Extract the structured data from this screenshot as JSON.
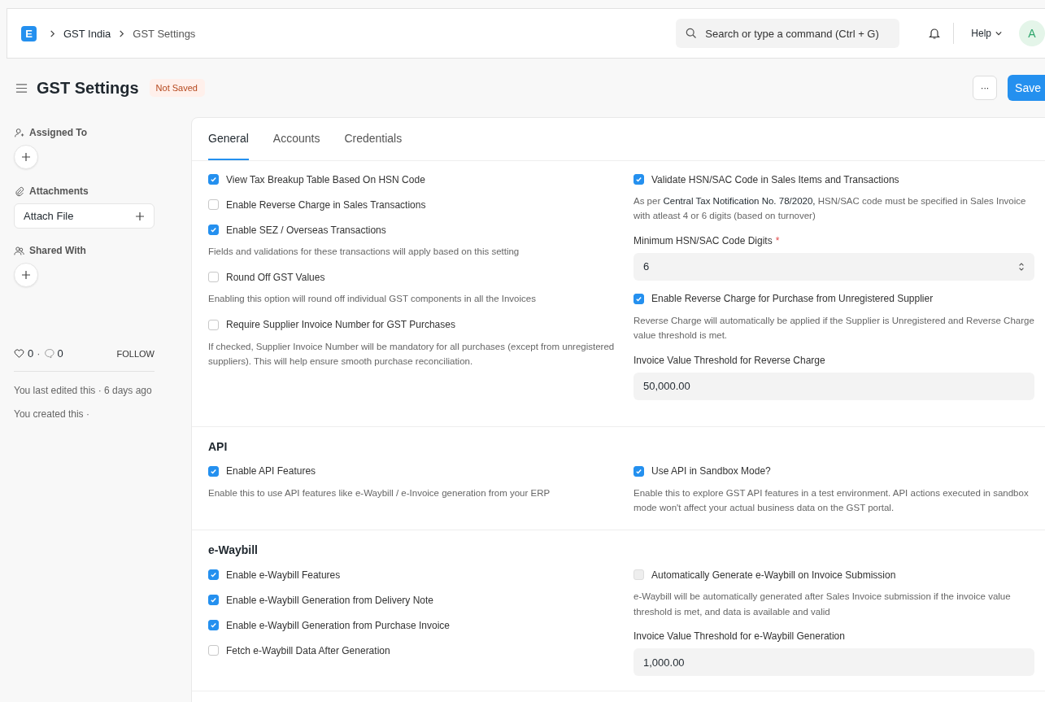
{
  "navbar": {
    "logo": "E",
    "breadcrumbs": [
      "GST India",
      "GST Settings"
    ],
    "search": {
      "placeholder": "Search or type a command (Ctrl + G)"
    },
    "help": "Help",
    "avatar": "A"
  },
  "page": {
    "title": "GST Settings",
    "status": "Not Saved",
    "more": "···",
    "save": "Save"
  },
  "sidebar": {
    "assigned_to": "Assigned To",
    "attachments": "Attachments",
    "attach_file": "Attach File",
    "shared_with": "Shared With",
    "likes": "0",
    "separator": "·",
    "comments": "0",
    "follow": "FOLLOW",
    "last_edited": "You last edited this · 6 days ago",
    "created": "You created this ·"
  },
  "tabs": [
    {
      "label": "General",
      "selected": true
    },
    {
      "label": "Accounts",
      "selected": false
    },
    {
      "label": "Credentials",
      "selected": false
    }
  ],
  "sections": [
    {
      "columns": [
        [
          {
            "kind": "checkbox",
            "label": "View Tax Breakup Table Based On HSN Code",
            "checked": true,
            "disabled": false
          },
          {
            "kind": "checkbox",
            "label": "Enable Reverse Charge in Sales Transactions",
            "checked": false,
            "disabled": false
          },
          {
            "kind": "checkbox",
            "label": "Enable SEZ / Overseas Transactions",
            "checked": true,
            "disabled": false,
            "description": "Fields and validations for these transactions will apply based on this setting"
          },
          {
            "kind": "checkbox",
            "label": "Round Off GST Values",
            "checked": false,
            "disabled": false,
            "description": "Enabling this option will round off individual GST components in all the Invoices"
          },
          {
            "kind": "checkbox",
            "label": "Require Supplier Invoice Number for GST Purchases",
            "checked": false,
            "disabled": false,
            "description": "If checked, Supplier Invoice Number will be mandatory for all purchases (except from unregistered suppliers). This will help ensure smooth purchase reconciliation."
          }
        ],
        [
          {
            "kind": "checkbox",
            "label": "Validate HSN/SAC Code in Sales Items and Transactions",
            "checked": true,
            "disabled": false,
            "description": "As per **Central Tax Notification No. 78/2020,** HSN/SAC code must be specified in Sales Invoice with atleast 4 or 6 digits (based on turnover)"
          },
          {
            "kind": "select",
            "label": "Minimum HSN/SAC Code Digits",
            "required": true,
            "required_mark": "*",
            "value": "6"
          },
          {
            "kind": "checkbox",
            "label": "Enable Reverse Charge for Purchase from Unregistered Supplier",
            "checked": true,
            "disabled": false,
            "description": "Reverse Charge will automatically be applied if the Supplier is Unregistered and Reverse Charge value threshold is met."
          },
          {
            "kind": "input",
            "label": "Invoice Value Threshold for Reverse Charge",
            "value": "50,000.00"
          }
        ]
      ]
    },
    {
      "title": "API",
      "columns": [
        [
          {
            "kind": "checkbox",
            "label": "Enable API Features",
            "checked": true,
            "disabled": false,
            "description": "Enable this to use API features like e-Waybill / e-Invoice generation from your ERP"
          }
        ],
        [
          {
            "kind": "checkbox",
            "label": "Use API in Sandbox Mode?",
            "checked": true,
            "disabled": false,
            "description": "Enable this to explore GST API features in a test environment. API actions executed in sandbox mode won't affect your actual business data on the GST portal."
          }
        ]
      ]
    },
    {
      "title": "e-Waybill",
      "columns": [
        [
          {
            "kind": "checkbox",
            "label": "Enable e-Waybill Features",
            "checked": true,
            "disabled": false
          },
          {
            "kind": "checkbox",
            "label": "Enable e-Waybill Generation from Delivery Note",
            "checked": true,
            "disabled": false
          },
          {
            "kind": "checkbox",
            "label": "Enable e-Waybill Generation from Purchase Invoice",
            "checked": true,
            "disabled": false
          },
          {
            "kind": "checkbox",
            "label": "Fetch e-Waybill Data After Generation",
            "checked": false,
            "disabled": false
          }
        ],
        [
          {
            "kind": "checkbox",
            "label": "Automatically Generate e-Waybill on Invoice Submission",
            "checked": false,
            "disabled": true,
            "description": "e-Waybill will be automatically generated after Sales Invoice submission if the invoice value threshold is met, and data is available and valid"
          },
          {
            "kind": "input",
            "label": "Invoice Value Threshold for e-Waybill Generation",
            "value": "1,000.00"
          }
        ]
      ]
    }
  ]
}
